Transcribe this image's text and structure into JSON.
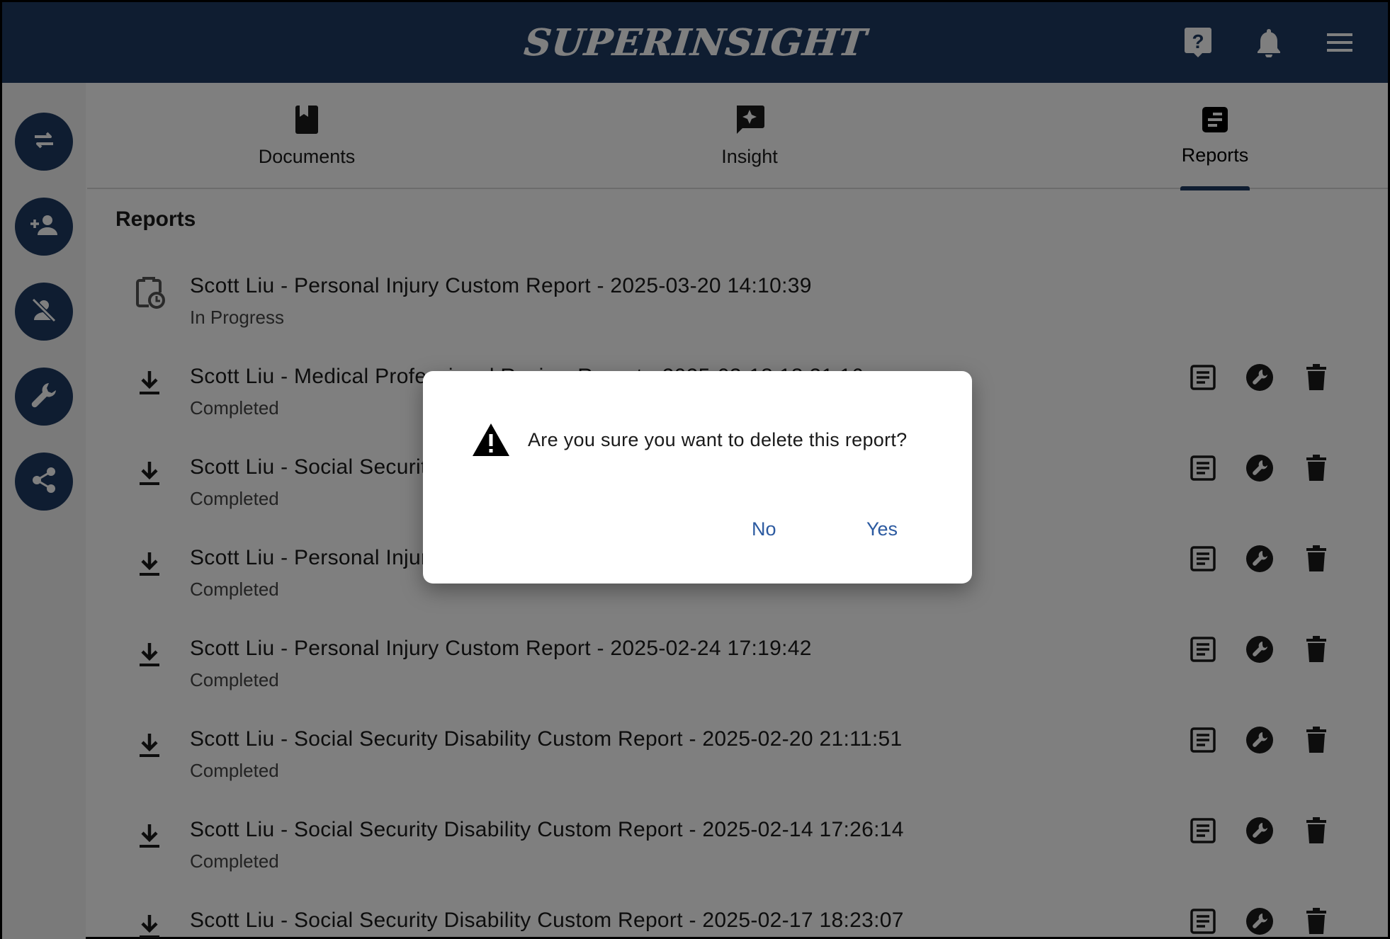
{
  "header": {
    "logo_text": "SUPERINSIGHT",
    "icons": [
      "help-icon",
      "bell-icon",
      "menu-icon"
    ],
    "colors": {
      "navy": "#1e3a62",
      "link_blue": "#2c5aa0"
    }
  },
  "rail": {
    "buttons": [
      {
        "name": "swap-icon"
      },
      {
        "name": "add-person-icon"
      },
      {
        "name": "person-off-icon"
      },
      {
        "name": "wrench-icon"
      },
      {
        "name": "share-icon"
      }
    ]
  },
  "tabs": [
    {
      "label": "Documents",
      "icon": "book-icon",
      "active": false
    },
    {
      "label": "Insight",
      "icon": "chat-sparkle-icon",
      "active": false
    },
    {
      "label": "Reports",
      "icon": "report-icon",
      "active": true
    }
  ],
  "section_title": "Reports",
  "reports": [
    {
      "title": "Scott Liu - Personal Injury Custom Report - 2025-03-20 14:10:39",
      "status": "In Progress",
      "lead_icon": "clipboard-clock-icon",
      "has_actions": false
    },
    {
      "title": "Scott Liu - Medical Professional Review Report - 2025-03-18 18:21:16",
      "status": "Completed",
      "lead_icon": "download-icon",
      "has_actions": true
    },
    {
      "title": "Scott Liu - Social Security Disability Custom Report - 2025-03-10 16:45:10",
      "status": "Completed",
      "lead_icon": "download-icon",
      "has_actions": true
    },
    {
      "title": "Scott Liu - Personal Injury Custom Report",
      "status": "Completed",
      "lead_icon": "download-icon",
      "has_actions": true
    },
    {
      "title": "Scott Liu - Personal Injury Custom Report - 2025-02-24 17:19:42",
      "status": "Completed",
      "lead_icon": "download-icon",
      "has_actions": true
    },
    {
      "title": "Scott Liu - Social Security Disability Custom Report - 2025-02-20 21:11:51",
      "status": "Completed",
      "lead_icon": "download-icon",
      "has_actions": true
    },
    {
      "title": "Scott Liu - Social Security Disability Custom Report - 2025-02-14 17:26:14",
      "status": "Completed",
      "lead_icon": "download-icon",
      "has_actions": true
    },
    {
      "title": "Scott Liu - Social Security Disability Custom Report - 2025-02-17 18:23:07",
      "status": "",
      "lead_icon": "download-icon",
      "has_actions": true
    }
  ],
  "dialog": {
    "message": "Are you sure you want to delete this report?",
    "no_label": "No",
    "yes_label": "Yes",
    "icon": "warning-icon"
  }
}
